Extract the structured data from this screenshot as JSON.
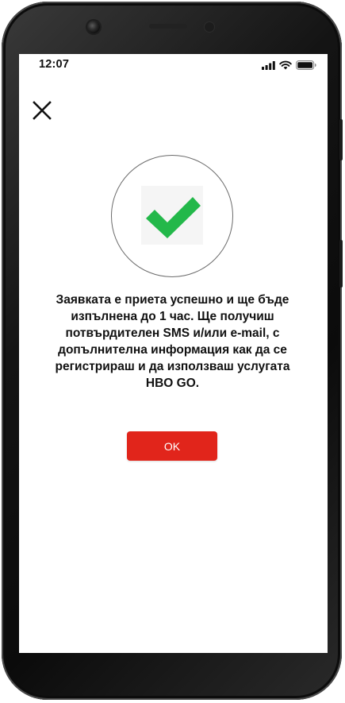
{
  "status_bar": {
    "time": "12:07",
    "icons": [
      "signal-icon",
      "wifi-icon",
      "battery-icon"
    ]
  },
  "close_icon": "close-icon",
  "success_icon": "checkmark-icon",
  "message": "Заявката е приета успешно и ще бъде изпълнена до 1 час. Ще получиш потвърдителен SMS и/или e-mail, с допълнителна информация как да се регистрираш и да използваш услугата HBO GO.",
  "ok_button": {
    "label": "OK"
  },
  "colors": {
    "accent": "#e1251b",
    "check_green": "#23b84a",
    "text": "#111111"
  }
}
